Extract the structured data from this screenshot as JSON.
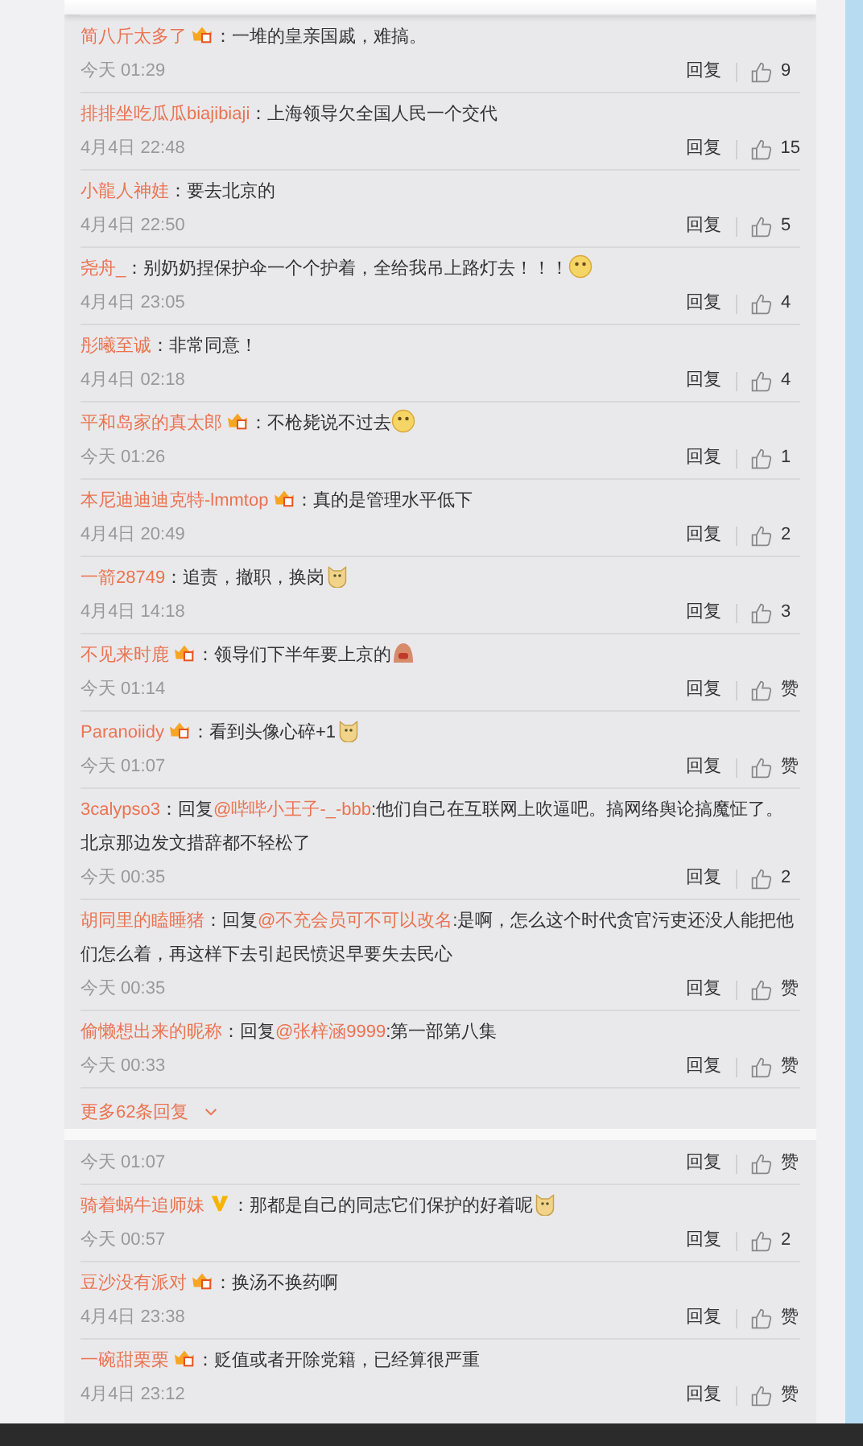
{
  "comments": [
    {
      "user": "简八斤太多了",
      "badge": {
        "kind": "vip"
      },
      "text": "：一堆的皇亲国戚，难搞。",
      "time": "今天 01:29",
      "reply": "回复",
      "likes": "9"
    },
    {
      "user": "排排坐吃瓜瓜biajibiaji",
      "text": "：上海领导欠全国人民一个交代",
      "time": "4月4日 22:48",
      "reply": "回复",
      "likes": "15"
    },
    {
      "user": "小龍人神娃",
      "text": "：要去北京的",
      "time": "4月4日 22:50",
      "reply": "回复",
      "likes": "5"
    },
    {
      "user": "尧舟_",
      "text": "：别奶奶捏保护伞一个个护着，全给我吊上路灯去！！！",
      "emoji": {
        "kind": "smiley"
      },
      "time": "4月4日 23:05",
      "reply": "回复",
      "likes": "4"
    },
    {
      "user": "彤曦至诚",
      "text": "：非常同意！",
      "time": "4月4日 02:18",
      "reply": "回复",
      "likes": "4"
    },
    {
      "user": "平和岛家的真太郎",
      "badge": {
        "kind": "vip"
      },
      "text": "：不枪毙说不过去",
      "emoji": {
        "kind": "smiley"
      },
      "time": "今天 01:26",
      "reply": "回复",
      "likes": "1"
    },
    {
      "user": "本尼迪迪迪克特-lmmtop",
      "badge": {
        "kind": "vip"
      },
      "text": "：真的是管理水平低下",
      "time": "4月4日 20:49",
      "reply": "回复",
      "likes": "2"
    },
    {
      "user": "一箭28749",
      "text": "：追责，撤职，换岗",
      "emoji": {
        "kind": "doge"
      },
      "time": "4月4日 14:18",
      "reply": "回复",
      "likes": "3"
    },
    {
      "user": "不见来时鹿",
      "badge": {
        "kind": "vip"
      },
      "text": "：领导们下半年要上京的",
      "emoji": {
        "kind": "figure"
      },
      "time": "今天 01:14",
      "reply": "回复",
      "likes": "赞"
    },
    {
      "user": "Paranoiidy",
      "badge": {
        "kind": "vip"
      },
      "text": "：看到头像心碎+1",
      "emoji": {
        "kind": "doge"
      },
      "time": "今天 01:07",
      "reply": "回复",
      "likes": "赞"
    },
    {
      "user": "3calypso3",
      "text": "：回复",
      "mention": "@哔哔小王子-_-bbb",
      "text_after": ":他们自己在互联网上吹逼吧。搞网络舆论搞魔怔了。北京那边发文措辞都不轻松了",
      "time": "今天 00:35",
      "reply": "回复",
      "likes": "2"
    },
    {
      "user": "胡同里的瞌睡猪",
      "text": "：回复",
      "mention": "@不充会员可不可以改名",
      "text_after": ":是啊，怎么这个时代贪官污吏还没人能把他们怎么着，再这样下去引起民愤迟早要失去民心",
      "time": "今天 00:35",
      "reply": "回复",
      "likes": "赞"
    },
    {
      "user": "偷懒想出来的昵称",
      "text": "：回复",
      "mention": "@张梓涵9999",
      "text_after": ":第一部第八集",
      "time": "今天 00:33",
      "reply": "回复",
      "likes": "赞"
    }
  ],
  "more_replies": "更多62条回复",
  "continued": {
    "time": "今天 01:07",
    "reply": "回复",
    "likes": "赞"
  },
  "comments_2": [
    {
      "user": "骑着蜗牛追师妹",
      "badge": {
        "kind": "v"
      },
      "text": "：那都是自己的同志它们保护的好着呢",
      "emoji": {
        "kind": "doge"
      },
      "time": "今天 00:57",
      "reply": "回复",
      "likes": "2"
    },
    {
      "user": "豆沙没有派对",
      "badge": {
        "kind": "vip"
      },
      "text": "：换汤不换药啊",
      "time": "4月4日 23:38",
      "reply": "回复",
      "likes": "赞"
    },
    {
      "user": "一碗甜栗栗",
      "badge": {
        "kind": "vip"
      },
      "text": "：贬值或者开除党籍，已经算很严重",
      "time": "4月4日 23:12",
      "reply": "回复",
      "likes": "赞"
    }
  ]
}
